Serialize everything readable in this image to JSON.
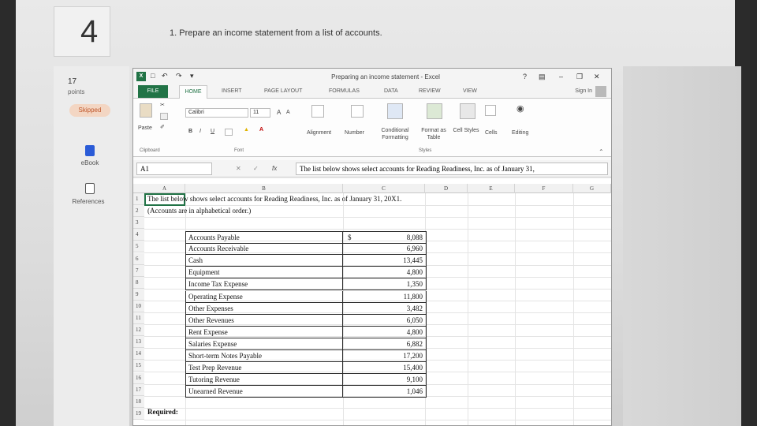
{
  "question": {
    "number": "4",
    "text": "1. Prepare an income statement from a list of accounts."
  },
  "sidebar": {
    "points_value": "17",
    "points_label": "points",
    "status": "Skipped",
    "links": [
      {
        "label": "eBook",
        "icon": "book-icon"
      },
      {
        "label": "References",
        "icon": "references-icon"
      }
    ]
  },
  "excel": {
    "title": "Preparing an income statement - Excel",
    "help": "?",
    "quick_access": [
      "save-icon",
      "undo-icon",
      "redo-icon",
      "customize-icon"
    ],
    "tabs": [
      "FILE",
      "HOME",
      "INSERT",
      "PAGE LAYOUT",
      "FORMULAS",
      "DATA",
      "REVIEW",
      "VIEW"
    ],
    "sign_in": "Sign In",
    "ribbon": {
      "paste": "Paste",
      "font_name": "Calibri",
      "font_size": "11",
      "grow_font": "A",
      "shrink_font": "A",
      "bold": "B",
      "italic": "I",
      "underline": "U",
      "alignment": "Alignment",
      "number": "Number",
      "conditional_formatting": "Conditional Formatting",
      "format_as_table": "Format as Table",
      "cell_styles": "Cell Styles",
      "cells": "Cells",
      "editing": "Editing",
      "groups": [
        "Clipboard",
        "Font",
        "Styles"
      ]
    },
    "name_box": "A1",
    "fx": "fx",
    "formula": "The list below shows select accounts for Reading Readiness, Inc. as of January 31,",
    "columns": [
      "A",
      "B",
      "C",
      "D",
      "E",
      "F",
      "G"
    ],
    "rows": [
      "1",
      "2",
      "3",
      "4",
      "5",
      "6",
      "7",
      "8",
      "9",
      "10",
      "11",
      "12",
      "13",
      "14",
      "15",
      "16",
      "17",
      "18",
      "19"
    ],
    "row1_text": "The list below shows select accounts for Reading Readiness, Inc. as of January 31, 20X1.",
    "row2_text": "(Accounts are in alphabetical order.)",
    "currency_symbol": "$",
    "accounts": [
      {
        "name": "Accounts Payable",
        "value": "8,088"
      },
      {
        "name": "Accounts Receivable",
        "value": "6,960"
      },
      {
        "name": "Cash",
        "value": "13,445"
      },
      {
        "name": "Equipment",
        "value": "4,800"
      },
      {
        "name": "Income Tax Expense",
        "value": "1,350"
      },
      {
        "name": "Operating Expense",
        "value": "11,800"
      },
      {
        "name": "Other Expenses",
        "value": "3,482"
      },
      {
        "name": "Other Revenues",
        "value": "6,050"
      },
      {
        "name": "Rent Expense",
        "value": "4,800"
      },
      {
        "name": "Salaries Expense",
        "value": "6,882"
      },
      {
        "name": "Short-term Notes Payable",
        "value": "17,200"
      },
      {
        "name": "Test Prep Revenue",
        "value": "15,400"
      },
      {
        "name": "Tutoring Revenue",
        "value": "9,100"
      },
      {
        "name": "Unearned Revenue",
        "value": "1,046"
      }
    ],
    "required_label": "Required:"
  },
  "colors": {
    "excel_green": "#217346",
    "skipped_bg": "#f3d6c3",
    "skipped_text": "#c0562a"
  }
}
